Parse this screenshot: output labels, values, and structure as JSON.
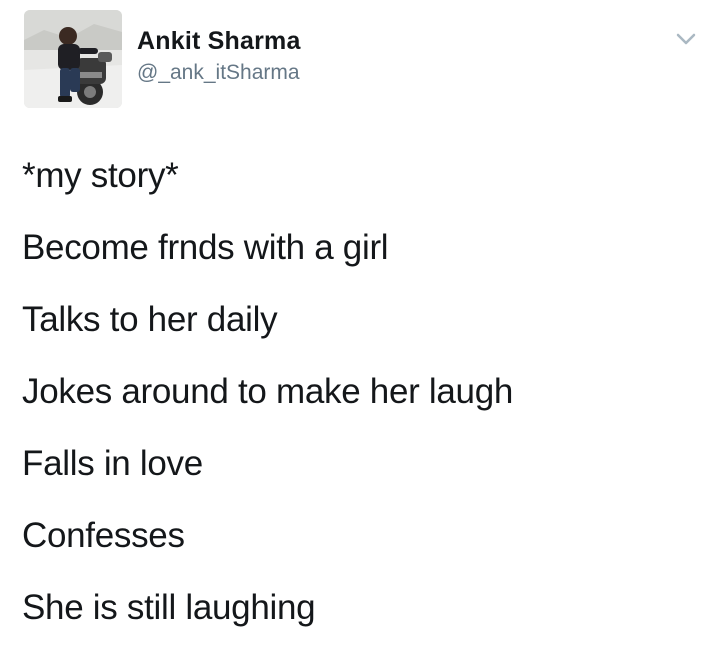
{
  "tweet": {
    "author": {
      "display_name": "Ankit Sharma",
      "handle": "@_ank_itSharma",
      "avatar": "avatar-photo-man-on-motorcycle"
    },
    "menu_icon": "chevron-down-icon",
    "lines": [
      "*my story*",
      "Become frnds with a girl",
      "Talks to her daily",
      "Jokes around to make her laugh",
      "Falls in love",
      "Confesses",
      "She is still laughing"
    ]
  },
  "colors": {
    "text_primary": "#14171a",
    "text_secondary": "#657786",
    "caret": "#aab8c2",
    "background": "#ffffff"
  }
}
